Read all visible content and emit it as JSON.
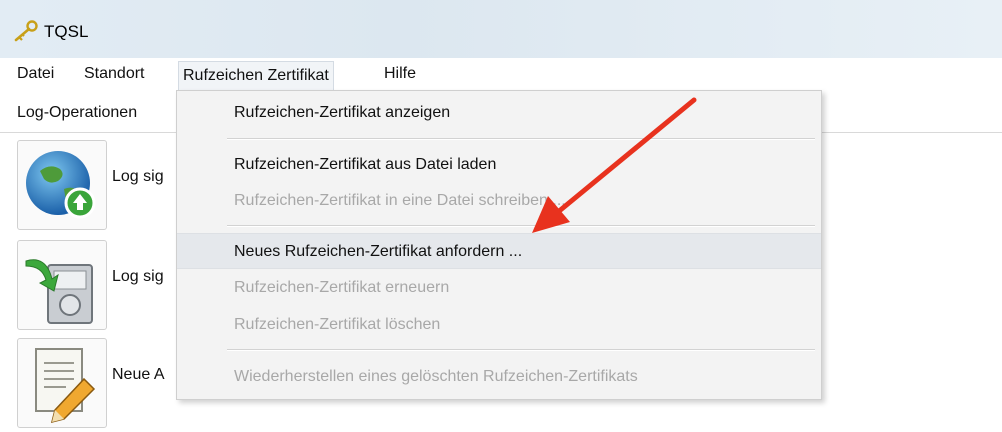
{
  "window": {
    "title": "TQSL",
    "icon": "key-icon"
  },
  "menubar": {
    "items": [
      {
        "label": "Datei"
      },
      {
        "label": "Standort"
      },
      {
        "label": "Rufzeichen Zertifikat"
      },
      {
        "label": "Hilfe"
      }
    ],
    "active_index": 2
  },
  "tabs": {
    "active_label": "Log-Operationen"
  },
  "operations": [
    {
      "icon": "globe-upload-icon",
      "label": "Log sig"
    },
    {
      "icon": "save-disk-icon",
      "label": "Log sig"
    },
    {
      "icon": "edit-document-icon",
      "label": "Neue A"
    }
  ],
  "dropdown": {
    "items": [
      {
        "label": "Rufzeichen-Zertifikat anzeigen",
        "enabled": true
      },
      {
        "label": "Rufzeichen-Zertifikat aus Datei laden",
        "enabled": true
      },
      {
        "label": "Rufzeichen-Zertifikat in eine Datei schreiben ...",
        "enabled": false
      },
      {
        "label": "Neues Rufzeichen-Zertifikat anfordern ...",
        "enabled": true,
        "highlighted": true
      },
      {
        "label": "Rufzeichen-Zertifikat erneuern",
        "enabled": false
      },
      {
        "label": "Rufzeichen-Zertifikat löschen",
        "enabled": false
      },
      {
        "label": "Wiederherstellen eines gelöschten Rufzeichen-Zertifikats",
        "enabled": false
      }
    ]
  },
  "annotation": {
    "arrow_color": "#e8321e"
  },
  "colors": {
    "titlebar": "#e2ecf4",
    "menu_bg": "#f3f3f3",
    "disabled_text": "#a8a8a8"
  }
}
